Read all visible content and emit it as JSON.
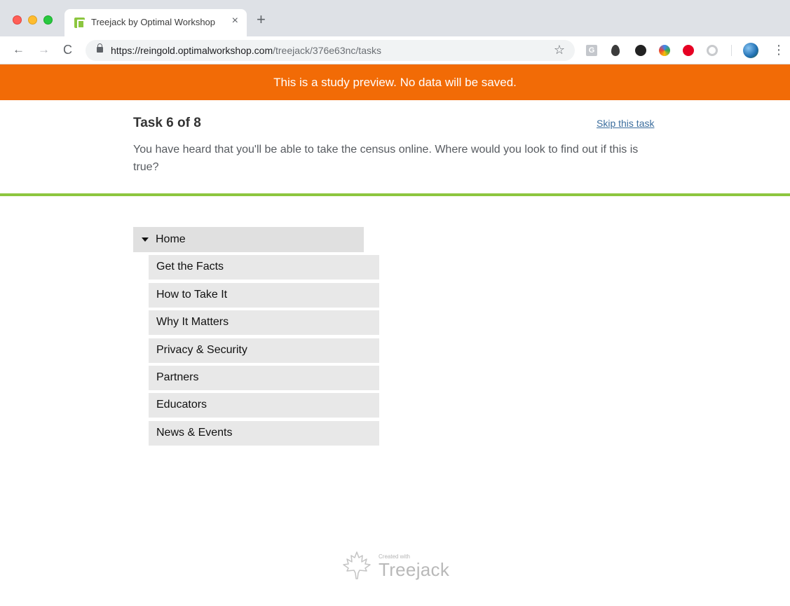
{
  "browser": {
    "tab_title": "Treejack by Optimal Workshop",
    "tab_close": "×",
    "new_tab": "+",
    "url_host": "https://reingold.optimalworkshop.com",
    "url_path": "/treejack/376e63nc/tasks",
    "nav": {
      "back": "←",
      "forward": "→",
      "reload": "C"
    },
    "star": "☆",
    "menu": "⋮",
    "extensions": [
      "grammarly-icon",
      "drop-icon",
      "dark-circle-icon",
      "compass-icon",
      "pinterest-icon",
      "grey-circle-icon"
    ],
    "ext_g_letter": "G"
  },
  "banner": {
    "text": "This is a study preview. No data will be saved.",
    "color": "#f26b06"
  },
  "task": {
    "title": "Task 6 of 8",
    "skip_label": "Skip this task",
    "description": "You have heard that you'll be able to take the census online. Where would you look to find out if this is true?"
  },
  "tree": {
    "root": "Home",
    "children": [
      "Get the Facts",
      "How to Take It",
      "Why It Matters",
      "Privacy & Security",
      "Partners",
      "Educators",
      "News & Events"
    ]
  },
  "footer": {
    "created_with": "Created with",
    "brand": "Treejack"
  },
  "colors": {
    "accent_green": "#8dc63f",
    "banner_orange": "#f26b06",
    "link_blue": "#3c6e9e"
  }
}
